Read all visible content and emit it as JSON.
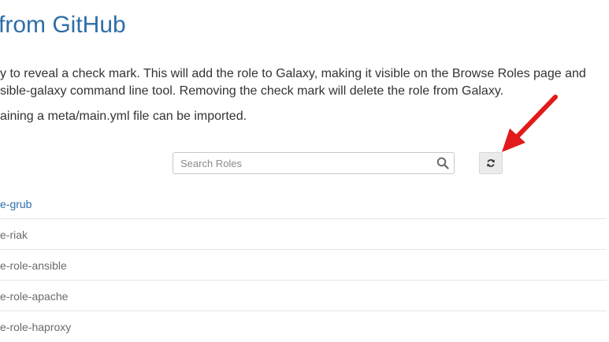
{
  "header": {
    "title": "from GitHub"
  },
  "instructions": {
    "line1": "y to reveal a check mark. This will add the role to Galaxy, making it visible on the Browse Roles page and",
    "line2": "sible-galaxy command line tool. Removing the check mark will delete the role from Galaxy.",
    "line3": "aining a meta/main.yml file can be imported."
  },
  "search": {
    "placeholder": "Search Roles",
    "value": ""
  },
  "toolbar": {
    "refresh_icon": "refresh-icon"
  },
  "roles": [
    {
      "name": "e-grub",
      "highlighted": true
    },
    {
      "name": "e-riak"
    },
    {
      "name": "e-role-ansible"
    },
    {
      "name": "e-role-apache"
    },
    {
      "name": "e-role-haproxy"
    }
  ],
  "colors": {
    "link": "#2f6ea7",
    "arrow": "#e11b1b"
  }
}
